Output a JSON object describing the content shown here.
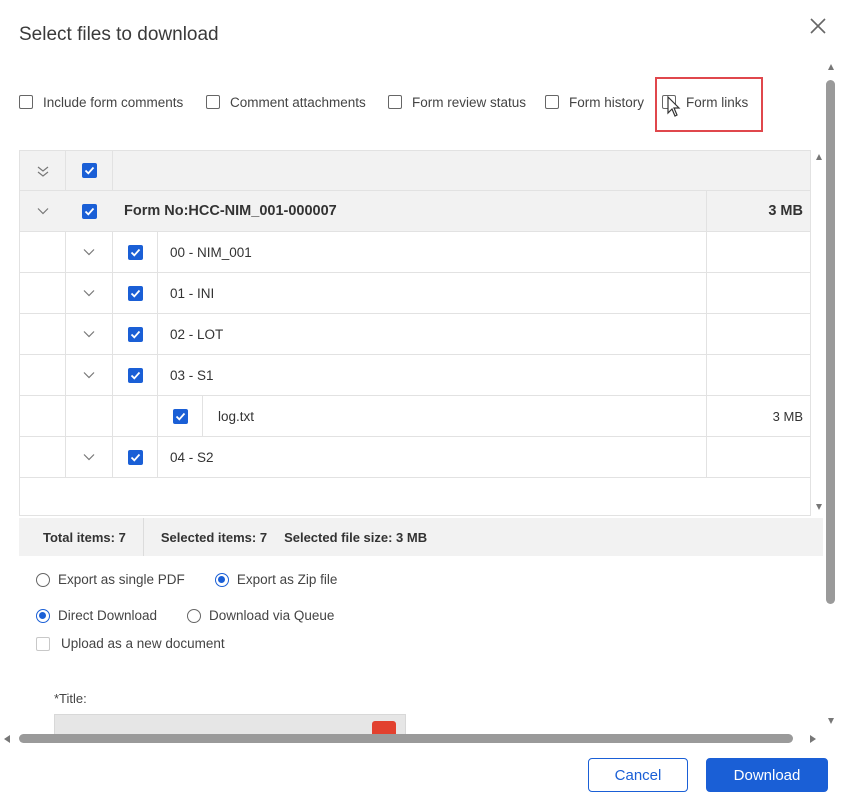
{
  "dialog": {
    "title": "Select files to download",
    "close_label": "close"
  },
  "options": [
    {
      "label": "Include form comments",
      "checked": false
    },
    {
      "label": "Comment attachments",
      "checked": false
    },
    {
      "label": "Form review status",
      "checked": false
    },
    {
      "label": "Form history",
      "checked": false
    },
    {
      "label": "Form links",
      "checked": false
    }
  ],
  "grid": {
    "header_checked": true,
    "group": {
      "label": "Form No:HCC-NIM_001-000007",
      "size": "3 MB",
      "checked": true
    },
    "rows": [
      {
        "label": "00 - NIM_001",
        "checked": true,
        "expandable": true,
        "size": ""
      },
      {
        "label": "01 - INI",
        "checked": true,
        "expandable": true,
        "size": ""
      },
      {
        "label": "02 - LOT",
        "checked": true,
        "expandable": true,
        "size": ""
      },
      {
        "label": "03 - S1",
        "checked": true,
        "expandable": true,
        "size": ""
      },
      {
        "label": "log.txt",
        "checked": true,
        "expandable": false,
        "size": "3 MB"
      },
      {
        "label": "04 - S2",
        "checked": true,
        "expandable": true,
        "size": ""
      }
    ]
  },
  "summary": {
    "total": "Total items: 7",
    "selected": "Selected items: 7",
    "selected_size": "Selected file size: 3 MB"
  },
  "export": {
    "single_pdf": "Export as single PDF",
    "zip": "Export as Zip file",
    "selected": "zip"
  },
  "delivery": {
    "direct": "Direct Download",
    "queue": "Download via Queue",
    "selected": "direct"
  },
  "upload": {
    "label": "Upload as a new document",
    "checked": false,
    "disabled": true
  },
  "title_field": {
    "label": "*Title:",
    "value": ""
  },
  "buttons": {
    "cancel": "Cancel",
    "download": "Download"
  },
  "colors": {
    "accent": "#1a5fd6",
    "highlight": "#e0474c",
    "error": "#e2412f"
  }
}
